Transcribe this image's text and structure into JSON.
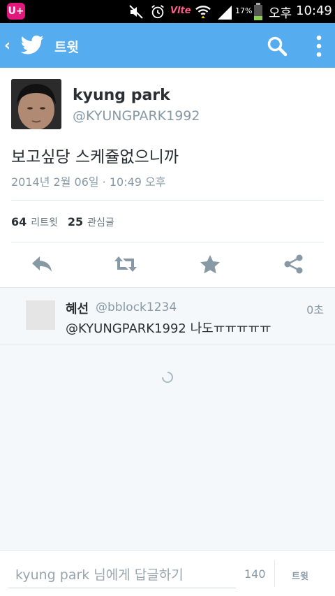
{
  "status_bar": {
    "carrier": "U+",
    "network": "Vlte",
    "battery": "17%",
    "ampm": "오후",
    "clock": "10:49"
  },
  "action_bar": {
    "title": "트윗",
    "accent": "#55acee"
  },
  "tweet": {
    "name": "kyung park",
    "handle": "@KYUNGPARK1992",
    "text": "보고싶당 스케쥴없으니까",
    "timestamp": "2014년 2월 06일 · 10:49 오후",
    "retweets_count": "64",
    "retweets_label": "리트윗",
    "favorites_count": "25",
    "favorites_label": "관심글"
  },
  "actions": [
    "reply-icon",
    "retweet-icon",
    "favorite-star-icon",
    "share-icon"
  ],
  "reply": {
    "name": "혜선",
    "handle": "@bblock1234",
    "time": "0초",
    "text": "@KYUNGPARK1992 나도ㅠㅠㅠㅠㅠ"
  },
  "compose": {
    "placeholder": "kyung park 님에게 답글하기",
    "char_count": "140",
    "send_label": "트윗"
  }
}
